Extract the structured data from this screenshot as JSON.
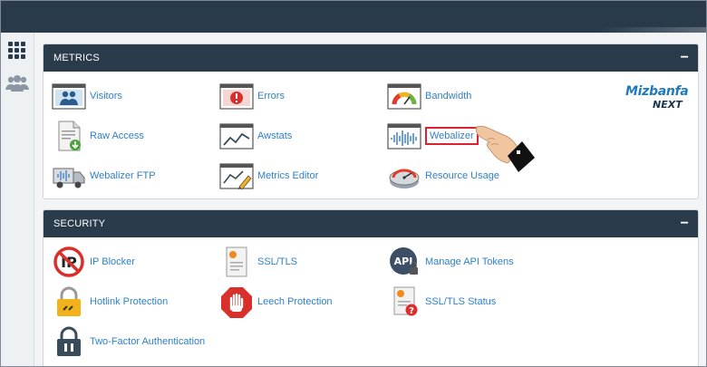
{
  "side_nav": {
    "items": [
      {
        "icon": "grid-icon"
      },
      {
        "icon": "users-icon"
      }
    ]
  },
  "metrics": {
    "title": "METRICS",
    "toggle": "−",
    "items": [
      {
        "label": "Visitors",
        "icon": "visitors-icon"
      },
      {
        "label": "Errors",
        "icon": "errors-icon"
      },
      {
        "label": "Bandwidth",
        "icon": "bandwidth-icon"
      },
      {
        "label": "Raw Access",
        "icon": "raw-access-icon"
      },
      {
        "label": "Awstats",
        "icon": "awstats-icon"
      },
      {
        "label": "Webalizer",
        "icon": "webalizer-icon"
      },
      {
        "label": "Webalizer FTP",
        "icon": "webalizer-ftp-icon"
      },
      {
        "label": "Metrics Editor",
        "icon": "metrics-editor-icon"
      },
      {
        "label": "Resource Usage",
        "icon": "resource-usage-icon"
      }
    ]
  },
  "security": {
    "title": "SECURITY",
    "toggle": "−",
    "items": [
      {
        "label": "IP Blocker",
        "icon": "ip-blocker-icon"
      },
      {
        "label": "SSL/TLS",
        "icon": "certificate-icon"
      },
      {
        "label": "Manage API Tokens",
        "icon": "api-tokens-icon"
      },
      {
        "label": "Hotlink Protection",
        "icon": "hotlink-lock-icon"
      },
      {
        "label": "Leech Protection",
        "icon": "leech-stop-hand-icon"
      },
      {
        "label": "SSL/TLS Status",
        "icon": "ssl-status-icon"
      },
      {
        "label": "Two-Factor Authentication",
        "icon": "two-factor-lock-icon"
      }
    ]
  },
  "logo": {
    "line1": "Mizbanfa",
    "line2": "NEXT"
  },
  "colors": {
    "header": "#2a3b4c",
    "link": "#2f80c8",
    "highlight": "#d9232e"
  }
}
